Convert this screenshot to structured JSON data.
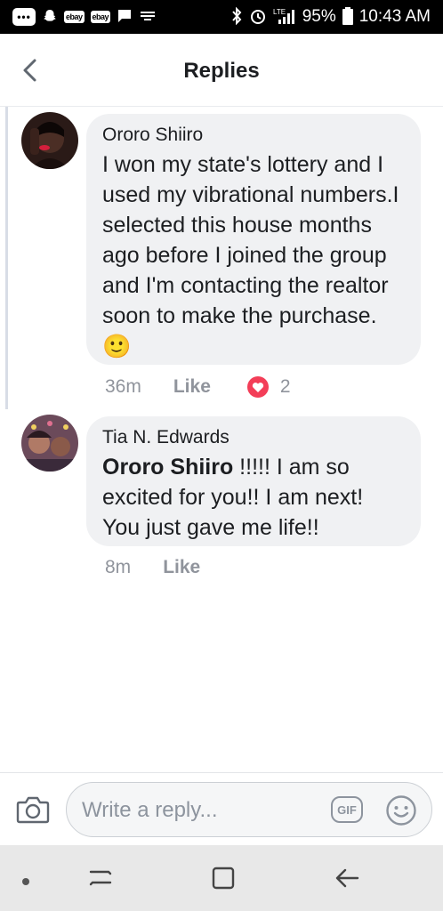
{
  "status_bar": {
    "left_badges": [
      "ebay",
      "ebay"
    ],
    "battery": "95%",
    "time": "10:43 AM",
    "network": "LTE",
    "icons": [
      "chat-dots-icon",
      "snapchat-icon",
      "ebay-icon",
      "ebay-icon",
      "message-icon",
      "cast-icon",
      "bluetooth-icon",
      "alarm-icon",
      "signal-icon",
      "battery-icon"
    ]
  },
  "header": {
    "title": "Replies",
    "back_icon": "chevron-left-icon"
  },
  "replies": [
    {
      "author": "Ororo Shiiro",
      "text": "I won my state's lottery and I used my  vibrational numbers.I selected this house months ago before I joined the group and I'm contacting the realtor soon to make the purchase.",
      "emoji": "🙂",
      "time": "36m",
      "like_label": "Like",
      "reaction_icon": "love-reaction-icon",
      "reaction_count": "2"
    },
    {
      "author": "Tia N. Edwards",
      "mention": "Ororo Shiiro",
      "text": " !!!!! I am so excited for you!! I am next! You just gave me life!!",
      "time": "8m",
      "like_label": "Like"
    }
  ],
  "composer": {
    "placeholder": "Write a reply...",
    "gif_label": "GIF",
    "camera_icon": "camera-icon",
    "emoji_icon": "smiley-icon"
  },
  "nav_bar": {
    "icons": [
      "dot-icon",
      "recent-apps-icon",
      "home-icon",
      "back-arrow-icon"
    ]
  },
  "colors": {
    "bubble": "#f0f1f3",
    "meta_text": "#90949c",
    "heart": "#f33e58",
    "thread_line": "#d8dde6"
  }
}
